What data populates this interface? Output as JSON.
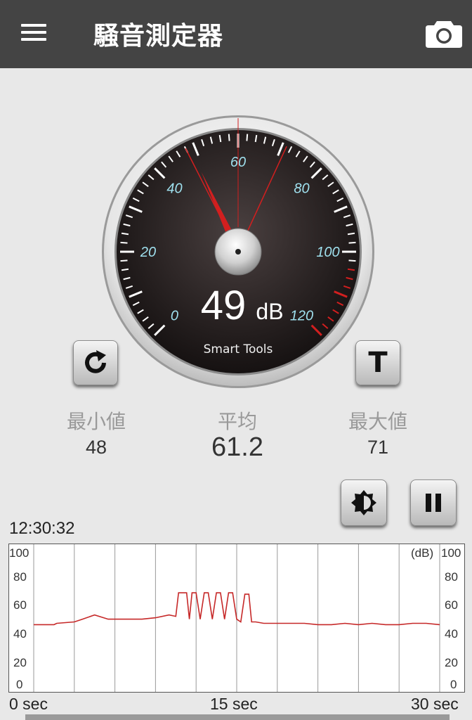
{
  "app": {
    "title": "騒音測定器"
  },
  "gauge": {
    "reading": "49",
    "unit": "dB",
    "brand": "Smart Tools",
    "scale_labels": [
      "0",
      "20",
      "40",
      "60",
      "80",
      "100",
      "120"
    ],
    "needle_value": 49,
    "min_marker": 48,
    "max_marker": 71,
    "accent_color": "#d21f1f",
    "tick_label_color": "#9fe0ee"
  },
  "stats": {
    "min_label": "最小値",
    "min_value": "48",
    "avg_label": "平均",
    "avg_value": "61.2",
    "max_label": "最大値",
    "max_value": "71"
  },
  "buttons": {
    "t_label": "T"
  },
  "graph": {
    "clock": "12:30:32",
    "unit_label": "(dB)",
    "y_labels": [
      "100",
      "80",
      "60",
      "40",
      "20",
      "0"
    ],
    "x_labels": [
      "0 sec",
      "15 sec",
      "30 sec"
    ],
    "line_color": "#c62828"
  },
  "chart_data": {
    "type": "line",
    "xlabel": "",
    "ylabel": "",
    "ylim": [
      0,
      100
    ],
    "xlim": [
      0,
      30
    ],
    "grid": true,
    "series": [
      {
        "x": [
          0,
          1.5,
          1.7,
          3,
          3.6,
          4.5,
          5.5,
          6.5,
          7,
          8,
          9,
          10,
          10.5,
          10.7,
          11.3,
          11.5,
          11.7,
          12,
          12.3,
          12.6,
          12.9,
          13.2,
          13.5,
          13.8,
          14.1,
          14.4,
          14.7,
          15,
          15.3,
          15.6,
          15.9,
          16.1,
          16.4,
          17,
          18,
          19,
          20,
          21,
          22,
          23,
          24,
          25,
          26,
          27,
          28,
          29,
          30
        ],
        "y": [
          48,
          48,
          49,
          50,
          52,
          55,
          52,
          52,
          52,
          52,
          53,
          55,
          54,
          71,
          71,
          52,
          71,
          71,
          52,
          71,
          71,
          52,
          71,
          71,
          52,
          71,
          71,
          52,
          50,
          70,
          70,
          50,
          50,
          49,
          49,
          49,
          49,
          48,
          48,
          49,
          48,
          49,
          48,
          48,
          49,
          49,
          48
        ]
      }
    ]
  }
}
